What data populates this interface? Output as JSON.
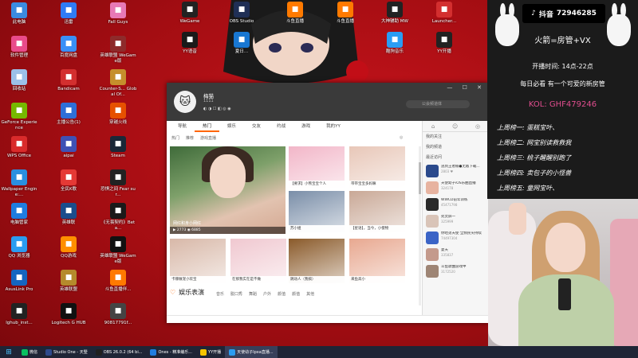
{
  "desktop_icons": [
    {
      "label": "此电脑",
      "icon": "computer-icon",
      "color": "#3b8be0",
      "col": 0,
      "row": 0
    },
    {
      "label": "软件管理",
      "icon": "apps-icon",
      "color": "#e94b8a",
      "col": 0,
      "row": 1
    },
    {
      "label": "回收站",
      "icon": "recycle-bin-icon",
      "color": "#9cc0e8",
      "col": 0,
      "row": 2
    },
    {
      "label": "GeForce Experience",
      "icon": "nvidia-icon",
      "color": "#76b900",
      "col": 0,
      "row": 3
    },
    {
      "label": "WPS Office",
      "icon": "wps-icon",
      "color": "#d92b2b",
      "col": 0,
      "row": 4
    },
    {
      "label": "Wallpaper Engine:...",
      "icon": "wallpaper-icon",
      "color": "#2a8fe0",
      "col": 0,
      "row": 5
    },
    {
      "label": "电脑管家",
      "icon": "shield-icon",
      "color": "#1f7de0",
      "col": 0,
      "row": 6
    },
    {
      "label": "QQ 浏览器",
      "icon": "qq-browser-icon",
      "color": "#2b9cf0",
      "col": 0,
      "row": 7
    },
    {
      "label": "AsusLink Pro",
      "icon": "asuslink-icon",
      "color": "#1565c0",
      "col": 0,
      "row": 8
    },
    {
      "label": "lghub_inst...",
      "icon": "logitech-icon",
      "color": "#222222",
      "col": 0,
      "row": 9
    },
    {
      "label": "迅雷",
      "icon": "thunder-icon",
      "color": "#2f7bf5",
      "col": 1,
      "row": 0
    },
    {
      "label": "百度网盘",
      "icon": "baidu-netdisk-icon",
      "color": "#3a8ff7",
      "col": 1,
      "row": 1
    },
    {
      "label": "Bandicam",
      "icon": "bandicam-icon",
      "color": "#d32f2f",
      "col": 1,
      "row": 2
    },
    {
      "label": "主播公告(1)",
      "icon": "document-icon",
      "color": "#2e6fd8",
      "col": 1,
      "row": 3
    },
    {
      "label": "aipai",
      "icon": "aipai-icon",
      "color": "#3f51b5",
      "col": 1,
      "row": 4
    },
    {
      "label": "全民K歌",
      "icon": "karaoke-icon",
      "color": "#e53935",
      "col": 1,
      "row": 5
    },
    {
      "label": "英雄联",
      "icon": "lol-icon",
      "color": "#1b4d8c",
      "col": 1,
      "row": 6
    },
    {
      "label": "QQ游戏",
      "icon": "qq-game-icon",
      "color": "#ff8f00",
      "col": 1,
      "row": 7
    },
    {
      "label": "英雄联盟",
      "icon": "lol-client-icon",
      "color": "#b58a2c",
      "col": 1,
      "row": 8
    },
    {
      "label": "Logitech G HUB",
      "icon": "ghub-icon",
      "color": "#111111",
      "col": 1,
      "row": 9
    },
    {
      "label": "Fall Guys",
      "icon": "fall-guys-icon",
      "color": "#e879b6",
      "col": 2,
      "row": 0
    },
    {
      "label": "英雄联盟 WeGame版",
      "icon": "wegame-lol-icon",
      "color": "#8e2b2b",
      "col": 2,
      "row": 1
    },
    {
      "label": "Counter-S... Global Of...",
      "icon": "csgo-icon",
      "color": "#c58f2c",
      "col": 2,
      "row": 2
    },
    {
      "label": "穿越火线",
      "icon": "crossfire-icon",
      "color": "#e65100",
      "col": 2,
      "row": 3
    },
    {
      "label": "Steam",
      "icon": "steam-icon",
      "color": "#1b2838",
      "col": 2,
      "row": 4
    },
    {
      "label": "恐惧之间 Fear sur...",
      "icon": "fear-icon",
      "color": "#222222",
      "col": 2,
      "row": 5
    },
    {
      "label": "《无畏契约》Beta...",
      "icon": "valorant-icon",
      "color": "#1a1a1a",
      "col": 2,
      "row": 6
    },
    {
      "label": "英雄联盟 WeGame版",
      "icon": "black-game-icon",
      "color": "#111111",
      "col": 2,
      "row": 7
    },
    {
      "label": "斗鱼直播伴...",
      "icon": "douyu-icon",
      "color": "#ff7a00",
      "col": 2,
      "row": 8
    },
    {
      "label": "90817791f...",
      "icon": "file-icon",
      "color": "#444444",
      "col": 2,
      "row": 9
    }
  ],
  "top_icons": [
    {
      "label": "WeGame",
      "icon": "wegame-icon",
      "color": "#222222"
    },
    {
      "label": "YY语音",
      "icon": "yy-icon",
      "color": "#1a1a1a"
    },
    {
      "label": "OBS Studio",
      "icon": "obs-icon",
      "color": "#1f2f55"
    },
    {
      "label": "夏日... ",
      "icon": "blue-arrow-icon",
      "color": "#1877d2"
    },
    {
      "label": "斗鱼直播",
      "icon": "douyu-live-icon",
      "color": "#ff7a00"
    },
    {
      "label": "斗鱼直播",
      "icon": "douyu-live2-icon",
      "color": "#ff7a00"
    },
    {
      "label": "大神辅助 MW",
      "icon": "mw-icon",
      "color": "#222222"
    },
    {
      "label": "酷狗音乐",
      "icon": "kugou-icon",
      "color": "#2a9df4"
    },
    {
      "label": "Launcher...",
      "icon": "launcher-icon",
      "color": "#d32f2f"
    },
    {
      "label": "YY开播",
      "icon": "yy-live-icon",
      "color": "#222222"
    }
  ],
  "app": {
    "username": "梅猫",
    "user_sub": "1111",
    "badges": "◐ ◑ ☐ ◧ ◎ ◉",
    "search_placeholder": "公会频道体",
    "controls": "— ☐ ✕",
    "nav_tabs": [
      "导航",
      "热门",
      "娱乐",
      "交友",
      "约战",
      "游戏",
      "我的YY"
    ],
    "sub_tabs": [
      "热门",
      "推荐",
      "游戏直播"
    ],
    "refresh": "◎",
    "featured": {
      "caption": "网红和身小网红",
      "meta": "▶ 2773 ◉ 6885"
    },
    "thumbs": [
      {
        "caption": "【要求】小熊宝宝个人"
      },
      {
        "caption": "带带宝宝多妈嘛"
      },
      {
        "caption": "苏小姐"
      },
      {
        "caption": "【星语】，当今，小傻物"
      },
      {
        "caption": "卡哪做宠小欢宝"
      },
      {
        "caption": "在那我实在是不做"
      },
      {
        "caption": "跳动人（我搞）"
      },
      {
        "caption": "来鱼高小"
      }
    ],
    "section_title": "娱乐表演",
    "section_tabs": [
      "音乐",
      "脱口秀",
      "舞蹈",
      "户外",
      "颜值",
      "颜值",
      "其他"
    ],
    "sidebar_tabs": [
      "⌂",
      "☺",
      "◎"
    ],
    "sidebar_menu": [
      "我的关注",
      "我的频道",
      "最近访问"
    ],
    "rooms": [
      {
        "title": "逃到王者榆●无敌下载...",
        "stat": "2803 ♥",
        "color": "#2b4a8c"
      },
      {
        "title": "天使幼子iOS乐曲直播",
        "stat": "324178",
        "color": "#e7b3a0"
      },
      {
        "title": "WWCD前年训练",
        "stat": "45471798",
        "color": "#2a2a2a"
      },
      {
        "title": "宛灵屏一",
        "stat": "325999",
        "color": "#d9c4b8"
      },
      {
        "title": "你哈弟天使  全频民尖持续",
        "stat": "74497304",
        "color": "#3b64c6"
      },
      {
        "title": "夏天",
        "stat": "335837",
        "color": "#c49a8c"
      },
      {
        "title": "斗鱼歌曲游戏中",
        "stat": "3172520",
        "color": "#9e8575"
      }
    ]
  },
  "panel": {
    "platform_logo": "♪",
    "platform": "抖音",
    "room_id": "72946285",
    "headline": "火箭=房管+VX",
    "hours": "开播时间: 14点-22点",
    "daily": "每日必看 有一个可爱的新房管",
    "kol": "KOL: GHF479246",
    "ranks": [
      "上周榜一: 蛋糕宝叶、",
      "上周榜二: 网宝别读救救我",
      "上周榜三: 桃子醒醒别跑了",
      "上周榜四: 卖包子的小怪兽",
      "上周榜五: 童网宝叶、"
    ]
  },
  "taskbar": [
    {
      "label": "",
      "icon": "windows-start-icon",
      "color": "#4cc3ff",
      "active": false
    },
    {
      "label": "微信",
      "icon": "wechat-icon",
      "color": "#07c160",
      "active": false
    },
    {
      "label": "Studio One - 天墅",
      "icon": "studio-one-icon",
      "color": "#2e4a8c",
      "active": false
    },
    {
      "label": "OBS 26.0.2 (64 bi...",
      "icon": "obs-task-icon",
      "color": "#202020",
      "active": false
    },
    {
      "label": "Ones - 精准编乐...",
      "icon": "ones-icon",
      "color": "#1f7de0",
      "active": false
    },
    {
      "label": "YY开播",
      "icon": "yy-task-icon",
      "color": "#f5c400",
      "active": false
    },
    {
      "label": "天使幼子Ipxa直播...",
      "icon": "yy-window-icon",
      "color": "#2b9cf0",
      "active": true
    }
  ]
}
